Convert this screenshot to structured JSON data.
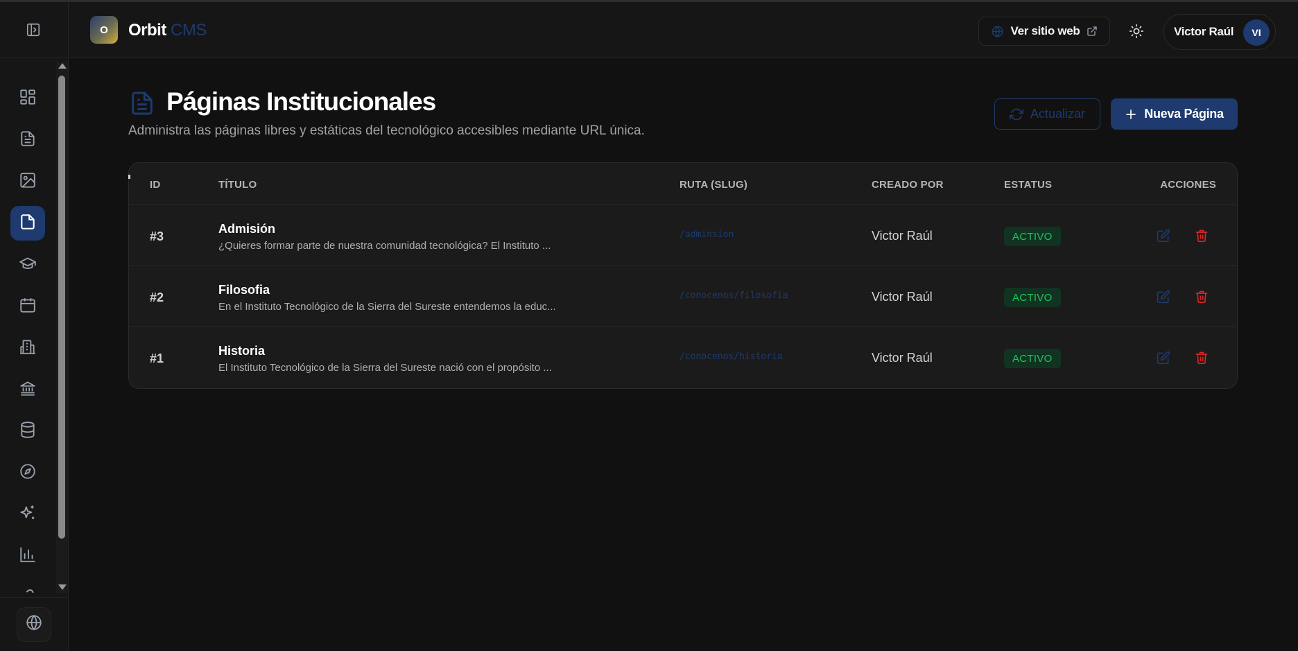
{
  "header": {
    "logo_letter": "O",
    "brand_primary": "Orbit",
    "brand_secondary": "CMS",
    "visit_site_label": "Ver sitio web",
    "user_name": "Victor Raúl",
    "avatar_initials": "VI"
  },
  "sidebar": {
    "items": [
      {
        "icon": "dashboard-icon",
        "active": false
      },
      {
        "icon": "document-lines-icon",
        "active": false
      },
      {
        "icon": "image-icon",
        "active": false
      },
      {
        "icon": "file-icon",
        "active": true
      },
      {
        "icon": "graduation-cap-icon",
        "active": false
      },
      {
        "icon": "calendar-icon",
        "active": false
      },
      {
        "icon": "building-icon",
        "active": false
      },
      {
        "icon": "institution-icon",
        "active": false
      },
      {
        "icon": "database-icon",
        "active": false
      },
      {
        "icon": "compass-icon",
        "active": false
      },
      {
        "icon": "sparkles-icon",
        "active": false
      },
      {
        "icon": "bar-chart-icon",
        "active": false
      }
    ],
    "bottom_icon": "globe-icon"
  },
  "page": {
    "title": "Páginas Institucionales",
    "subtitle": "Administra las páginas libres y estáticas del tecnológico accesibles mediante URL única.",
    "refresh_label": "Actualizar",
    "new_label": "Nueva Página"
  },
  "table": {
    "columns": [
      "ID",
      "TÍTULO",
      "RUTA (SLUG)",
      "CREADO POR",
      "ESTATUS",
      "ACCIONES"
    ],
    "rows": [
      {
        "id": "#3",
        "title": "Admisión",
        "excerpt": "¿Quieres formar parte de nuestra comunidad tecnológica? El Instituto ...",
        "slug": "/adminsion",
        "author": "Victor Raúl",
        "status": "ACTIVO"
      },
      {
        "id": "#2",
        "title": "Filosofia",
        "excerpt": "En el Instituto Tecnológico de la Sierra del Sureste entendemos la educ...",
        "slug": "/conocenos/filosofia",
        "author": "Victor Raúl",
        "status": "ACTIVO"
      },
      {
        "id": "#1",
        "title": "Historia",
        "excerpt": "El Instituto Tecnológico de la Sierra del Sureste nació con el propósito ...",
        "slug": "/conocenos/historia",
        "author": "Victor Raúl",
        "status": "ACTIVO"
      }
    ]
  },
  "colors": {
    "accent": "#1e3a6e",
    "background": "#111111",
    "status_active": "#22c55e",
    "danger": "#dc2626"
  }
}
